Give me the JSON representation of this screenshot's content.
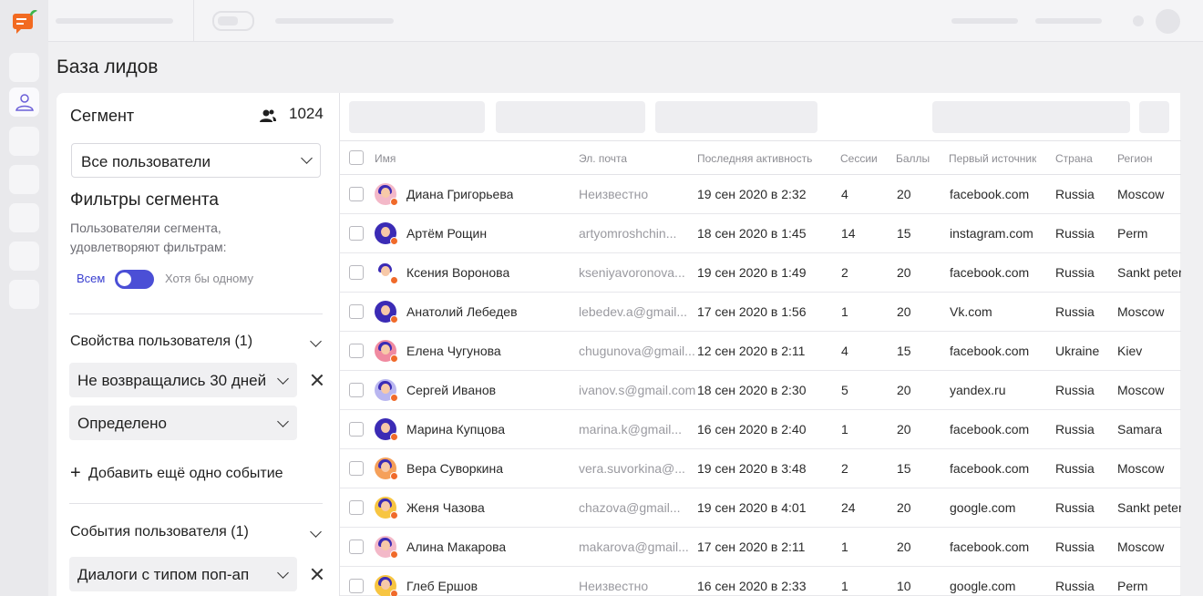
{
  "page": {
    "title": "База лидов"
  },
  "colors": {
    "accent": "#4b4fd6",
    "status_dot": "#f06a2a"
  },
  "rail": {
    "active_icon": "users-icon"
  },
  "segment": {
    "title": "Сегмент",
    "count": "1024",
    "selected": "Все пользователи",
    "filters_title": "Фильтры сегмента",
    "filters_desc": "Пользователяи сегмента, удовлетворяют фильтрам:",
    "toggle_left": "Всем",
    "toggle_right": "Хотя бы одному",
    "props_title": "Свойства пользователя (1)",
    "prop_condition": "Не возвращались 30 дней",
    "prop_value": "Определено",
    "add_event": "Добавить ещё одно событие",
    "events_title": "События пользователя (1)",
    "event_value": "Диалоги с типом поп-ап"
  },
  "table": {
    "columns": [
      "Имя",
      "Эл. почта",
      "Последняя активность",
      "Сессии",
      "Баллы",
      "Первый источник",
      "Страна",
      "Регион"
    ],
    "rows": [
      {
        "name": "Диана Григорьева",
        "email": "Неизвестно",
        "last": "19 сен 2020 в 2:32",
        "sessions": "4",
        "points": "20",
        "source": "facebook.com",
        "country": "Russia",
        "region": "Moscow",
        "bg": "#f3b8c8"
      },
      {
        "name": "Артём Рощин",
        "email": "artyomroshchin...",
        "last": "18 сен 2020 в 1:45",
        "sessions": "14",
        "points": "15",
        "source": "instagram.com",
        "country": "Russia",
        "region": "Perm",
        "bg": "#3b2bb5"
      },
      {
        "name": "Ксения Воронова",
        "email": "kseniyavoronova...",
        "last": "19 сен 2020 в 1:49",
        "sessions": "2",
        "points": "20",
        "source": "facebook.com",
        "country": "Russia",
        "region": "Sankt peter",
        "bg": "#ffffff"
      },
      {
        "name": "Анатолий Лебедев",
        "email": "lebedev.a@gmail...",
        "last": "17 сен 2020 в 1:56",
        "sessions": "1",
        "points": "20",
        "source": "Vk.com",
        "country": "Russia",
        "region": "Moscow",
        "bg": "#3b2bb5"
      },
      {
        "name": "Елена Чугунова",
        "email": "chugunova@gmail...",
        "last": "12 сен 2020 в 2:11",
        "sessions": "4",
        "points": "15",
        "source": "facebook.com",
        "country": "Ukraine",
        "region": "Kiev",
        "bg": "#f08aa0"
      },
      {
        "name": "Сергей Иванов",
        "email": "ivanov.s@gmail.com",
        "last": "18 сен 2020 в 2:30",
        "sessions": "5",
        "points": "20",
        "source": "yandex.ru",
        "country": "Russia",
        "region": "Moscow",
        "bg": "#b9b6f0"
      },
      {
        "name": "Марина Купцова",
        "email": "marina.k@gmail...",
        "last": "16 сен 2020 в 2:40",
        "sessions": "1",
        "points": "20",
        "source": "facebook.com",
        "country": "Russia",
        "region": "Samara",
        "bg": "#3b2bb5"
      },
      {
        "name": "Вера Суворкина",
        "email": "vera.suvorkina@...",
        "last": "19 сен 2020 в 3:48",
        "sessions": "2",
        "points": "15",
        "source": "facebook.com",
        "country": "Russia",
        "region": "Moscow",
        "bg": "#f5a05a"
      },
      {
        "name": "Женя Чазова",
        "email": "chazova@gmail...",
        "last": "19 сен 2020 в 4:01",
        "sessions": "24",
        "points": "20",
        "source": "google.com",
        "country": "Russia",
        "region": "Sankt peter",
        "bg": "#f7c542"
      },
      {
        "name": "Алина Макарова",
        "email": "makarova@gmail...",
        "last": "17 сен 2020 в 2:11",
        "sessions": "1",
        "points": "20",
        "source": "facebook.com",
        "country": "Russia",
        "region": "Moscow",
        "bg": "#f3b8c8"
      },
      {
        "name": "Глеб Ершов",
        "email": "Неизвестно",
        "last": "16 сен 2020 в 2:33",
        "sessions": "1",
        "points": "10",
        "source": "google.com",
        "country": "Russia",
        "region": "Perm",
        "bg": "#f7c542"
      }
    ]
  }
}
